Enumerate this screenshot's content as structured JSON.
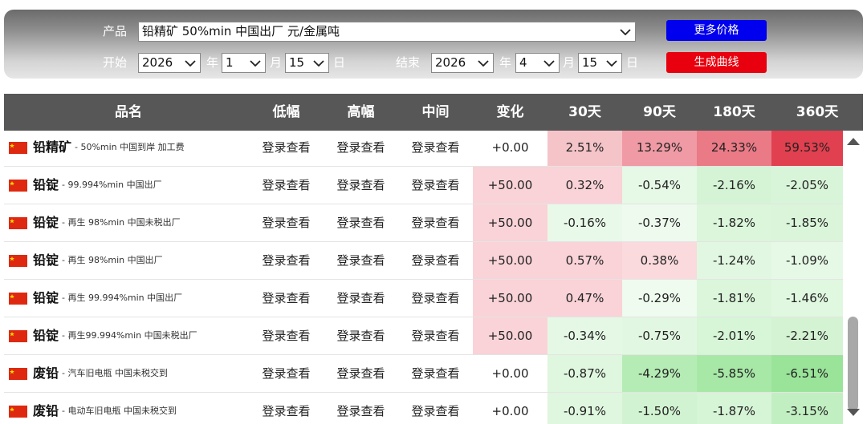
{
  "controls": {
    "product_label": "产品",
    "product_value": "铅精矿 50%min 中国出厂 元/金属吨",
    "start_label": "开始",
    "end_label": "结束",
    "start_year": "2026",
    "start_month": "1",
    "start_day": "15",
    "end_year": "2026",
    "end_month": "4",
    "end_day": "15",
    "year_unit": "年",
    "month_unit": "月",
    "day_unit": "日",
    "more_prices_button": "更多价格",
    "generate_curve_button": "生成曲线",
    "more_prices_color": "#0000ee",
    "generate_curve_color": "#e8000e"
  },
  "table": {
    "headers": [
      "品名",
      "低幅",
      "高幅",
      "中间",
      "变化",
      "30天",
      "90天",
      "180天",
      "360天"
    ],
    "rows": [
      {
        "name": "铅精矿",
        "desc": "50%min 中国到岸 加工费",
        "low": "登录查看",
        "high": "登录查看",
        "mid": "登录查看",
        "change": "+0.00",
        "d30": "2.51%",
        "d90": "13.29%",
        "d180": "24.33%",
        "d360": "59.53%"
      },
      {
        "name": "铅锭",
        "desc": "99.994%min 中国出厂",
        "low": "登录查看",
        "high": "登录查看",
        "mid": "登录查看",
        "change": "+50.00",
        "d30": "0.32%",
        "d90": "-0.54%",
        "d180": "-2.16%",
        "d360": "-2.05%"
      },
      {
        "name": "铅锭",
        "desc": "再生 98%min 中国未税出厂",
        "low": "登录查看",
        "high": "登录查看",
        "mid": "登录查看",
        "change": "+50.00",
        "d30": "-0.16%",
        "d90": "-0.37%",
        "d180": "-1.82%",
        "d360": "-1.85%"
      },
      {
        "name": "铅锭",
        "desc": "再生 98%min 中国出厂",
        "low": "登录查看",
        "high": "登录查看",
        "mid": "登录查看",
        "change": "+50.00",
        "d30": "0.57%",
        "d90": "0.38%",
        "d180": "-1.24%",
        "d360": "-1.09%"
      },
      {
        "name": "铅锭",
        "desc": "再生 99.994%min 中国出厂",
        "low": "登录查看",
        "high": "登录查看",
        "mid": "登录查看",
        "change": "+50.00",
        "d30": "0.47%",
        "d90": "-0.29%",
        "d180": "-1.81%",
        "d360": "-1.46%"
      },
      {
        "name": "铅锭",
        "desc": "再生99.994%min 中国未税出厂",
        "low": "登录查看",
        "high": "登录查看",
        "mid": "登录查看",
        "change": "+50.00",
        "d30": "-0.34%",
        "d90": "-0.75%",
        "d180": "-2.01%",
        "d360": "-2.21%"
      },
      {
        "name": "废铅",
        "desc": "汽车旧电瓶 中国未税交到",
        "low": "登录查看",
        "high": "登录查看",
        "mid": "登录查看",
        "change": "+0.00",
        "d30": "-0.87%",
        "d90": "-4.29%",
        "d180": "-5.85%",
        "d360": "-6.51%"
      },
      {
        "name": "废铅",
        "desc": "电动车旧电瓶 中国未税交到",
        "low": "登录查看",
        "high": "登录查看",
        "mid": "登录查看",
        "change": "+0.00",
        "d30": "-0.91%",
        "d90": "-1.50%",
        "d180": "-1.87%",
        "d360": "-3.15%"
      }
    ]
  }
}
